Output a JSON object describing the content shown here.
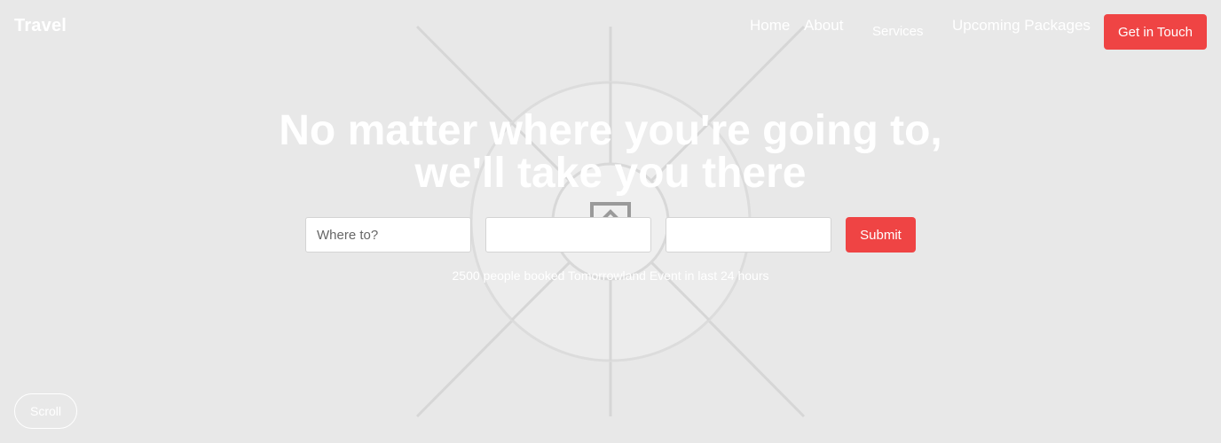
{
  "header": {
    "brand": "Travel",
    "nav": {
      "home": "Home",
      "about": "About",
      "services": "Services",
      "packages": "Upcoming Packages"
    },
    "cta_label": "Get in Touch"
  },
  "hero": {
    "title": "No matter where you're going to, we'll take you there",
    "search": {
      "destination_placeholder": "Where to?",
      "field2_value": "",
      "field3_value": "",
      "submit_label": "Submit"
    },
    "booked_text": "2500 people booked Tomorrowland Event in last 24 hours"
  },
  "scroll_label": "Scroll",
  "colors": {
    "accent": "#ef4444",
    "background": "#e8e8e8",
    "text_on_bg": "#ffffff"
  },
  "background_image": {
    "icon": "image-placeholder-icon"
  }
}
